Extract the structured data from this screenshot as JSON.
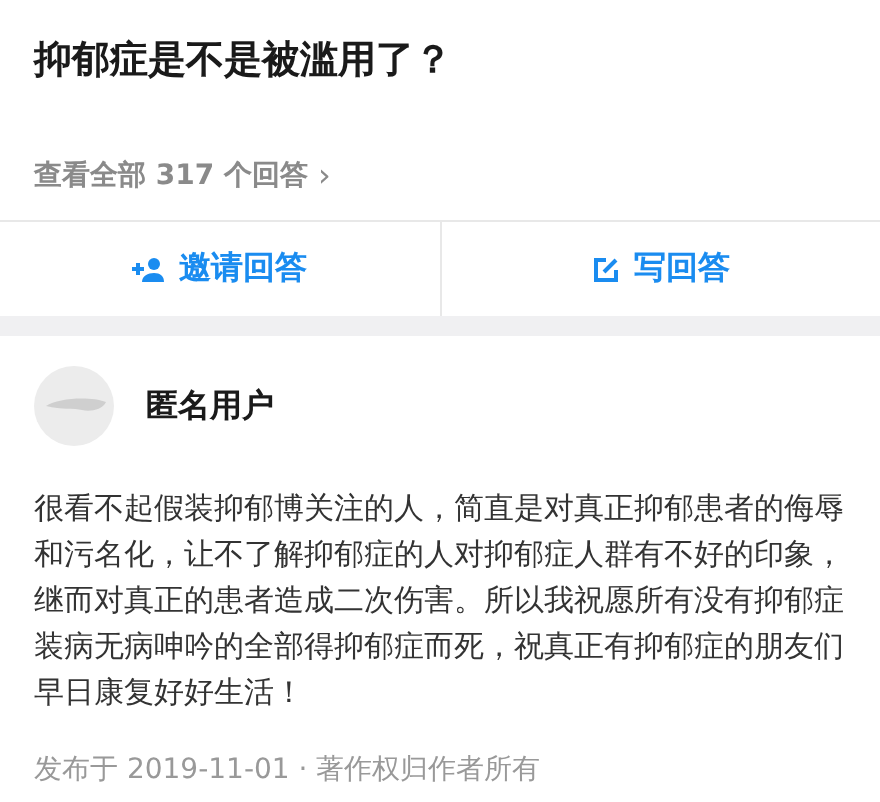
{
  "question": {
    "title": "抑郁症是不是被滥用了？",
    "all_answers": "查看全部 317 个回答",
    "chevron": "›"
  },
  "actions": [
    {
      "kind": "invite",
      "label": "邀请回答"
    },
    {
      "kind": "write",
      "label": "写回答"
    }
  ],
  "answer": {
    "author": "匿名用户",
    "body": "很看不起假装抑郁博关注的人，简直是对真正抑郁患者的侮辱和污名化，让不了解抑郁症的人对抑郁症人群有不好的印象，继而对真正的患者造成二次伤害。所以我祝愿所有没有抑郁症装病无病呻吟的全部得抑郁症而死，祝真正有抑郁症的朋友们早日康复好好生活！",
    "footer": "发布于 2019-11-01 · 著作权归作者所有"
  }
}
